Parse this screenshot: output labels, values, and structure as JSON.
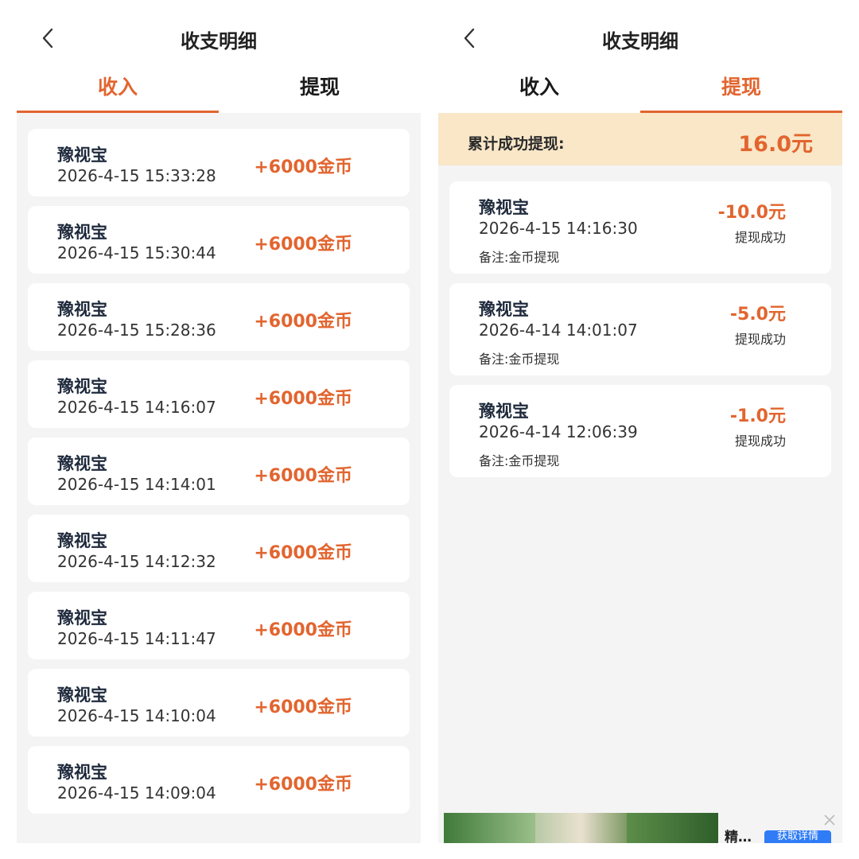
{
  "header": {
    "title": "收支明细"
  },
  "tabs": {
    "income": "收入",
    "withdraw": "提现"
  },
  "income_list": [
    {
      "name": "豫视宝",
      "date": "2026-4-15 15:33:28",
      "amount": "+6000金币"
    },
    {
      "name": "豫视宝",
      "date": "2026-4-15 15:30:44",
      "amount": "+6000金币"
    },
    {
      "name": "豫视宝",
      "date": "2026-4-15 15:28:36",
      "amount": "+6000金币"
    },
    {
      "name": "豫视宝",
      "date": "2026-4-15 14:16:07",
      "amount": "+6000金币"
    },
    {
      "name": "豫视宝",
      "date": "2026-4-15 14:14:01",
      "amount": "+6000金币"
    },
    {
      "name": "豫视宝",
      "date": "2026-4-15 14:12:32",
      "amount": "+6000金币"
    },
    {
      "name": "豫视宝",
      "date": "2026-4-15 14:11:47",
      "amount": "+6000金币"
    },
    {
      "name": "豫视宝",
      "date": "2026-4-15 14:10:04",
      "amount": "+6000金币"
    },
    {
      "name": "豫视宝",
      "date": "2026-4-15 14:09:04",
      "amount": "+6000金币"
    }
  ],
  "withdraw_summary": {
    "label": "累计成功提现:",
    "total": "16.0元"
  },
  "withdraw_list": [
    {
      "name": "豫视宝",
      "date": "2026-4-15 14:16:30",
      "note": "备注:金币提现",
      "amount": "-10.0元",
      "status": "提现成功"
    },
    {
      "name": "豫视宝",
      "date": "2026-4-14 14:01:07",
      "note": "备注:金币提现",
      "amount": "-5.0元",
      "status": "提现成功"
    },
    {
      "name": "豫视宝",
      "date": "2026-4-14 12:06:39",
      "note": "备注:金币提现",
      "amount": "-1.0元",
      "status": "提现成功"
    }
  ],
  "ad": {
    "title": "精…",
    "button": "获取详情"
  },
  "colors": {
    "accent": "#e2652f",
    "summary_bg": "#f9e7c8",
    "page_bg": "#f4f4f4",
    "ad_button": "#2f7cf6"
  },
  "icons": {
    "back": "chevron-left-icon",
    "close": "close-icon"
  }
}
